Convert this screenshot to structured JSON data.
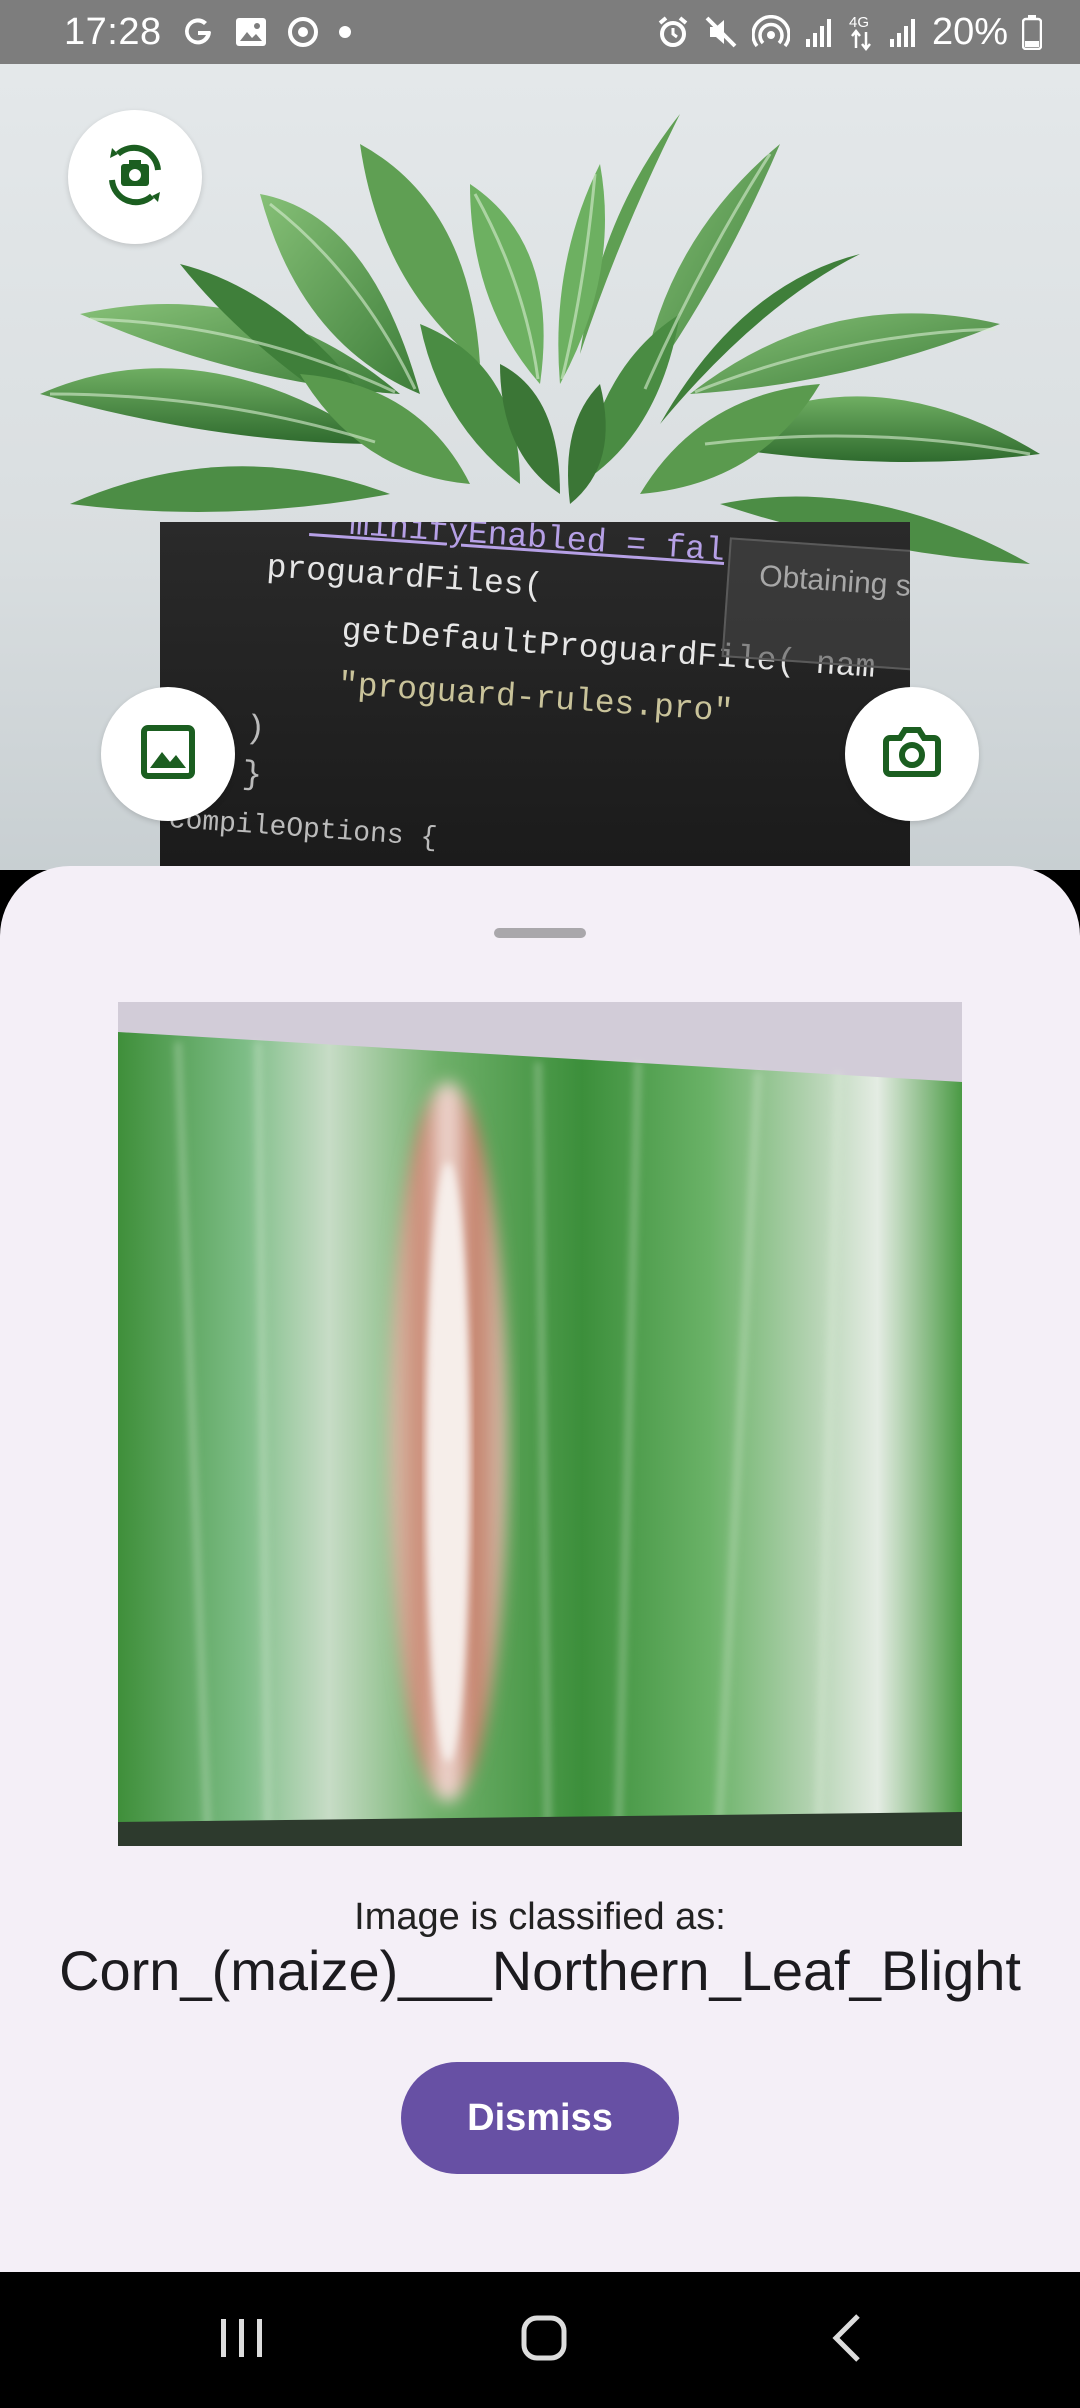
{
  "status_bar": {
    "time": "17:28",
    "battery": "20%",
    "left_icons": [
      "google-icon",
      "gallery-icon",
      "sync-icon",
      "dot-icon"
    ],
    "right_icons": [
      "alarm-icon",
      "mute-icon",
      "hotspot-icon",
      "signal-icon",
      "4g-icon",
      "signal-icon",
      "battery-icon"
    ]
  },
  "preview": {
    "code_lines": {
      "line1": "  minifyEnabled = fal",
      "line2": "proguardFiles(",
      "line3": "    getDefaultProguardFile( nam",
      "line4": "    \"proguard-rules.pro\"",
      "line5": ")",
      "line6": "}",
      "line7": "compileOptions {"
    },
    "popup_text": "Obtaining s"
  },
  "buttons": {
    "switch_camera": "switch-camera-icon",
    "gallery": "gallery-icon",
    "capture": "camera-icon"
  },
  "sheet": {
    "caption": "Image is classified as:",
    "result": "Corn_(maize)___Northern_Leaf_Blight",
    "dismiss": "Dismiss"
  },
  "nav": {
    "recents": "recents-icon",
    "home": "home-icon",
    "back": "back-icon"
  },
  "colors": {
    "accent": "#6750a4",
    "sheet_bg": "#f4eff7",
    "icon_green": "#1b5e20",
    "status_bar": "#7d7d7d"
  }
}
